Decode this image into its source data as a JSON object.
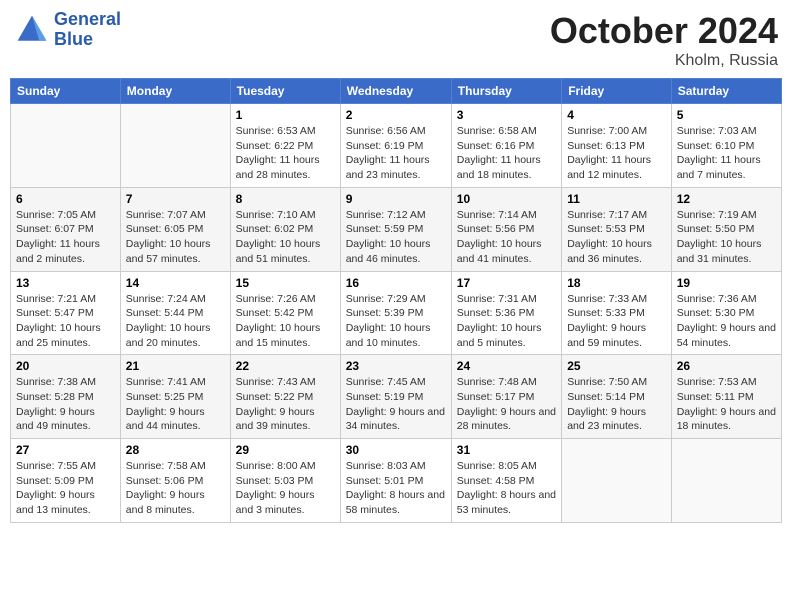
{
  "header": {
    "logo_line1": "General",
    "logo_line2": "Blue",
    "month": "October 2024",
    "location": "Kholm, Russia"
  },
  "weekdays": [
    "Sunday",
    "Monday",
    "Tuesday",
    "Wednesday",
    "Thursday",
    "Friday",
    "Saturday"
  ],
  "weeks": [
    [
      {
        "day": "",
        "info": ""
      },
      {
        "day": "",
        "info": ""
      },
      {
        "day": "1",
        "sunrise": "6:53 AM",
        "sunset": "6:22 PM",
        "daylight": "11 hours and 28 minutes."
      },
      {
        "day": "2",
        "sunrise": "6:56 AM",
        "sunset": "6:19 PM",
        "daylight": "11 hours and 23 minutes."
      },
      {
        "day": "3",
        "sunrise": "6:58 AM",
        "sunset": "6:16 PM",
        "daylight": "11 hours and 18 minutes."
      },
      {
        "day": "4",
        "sunrise": "7:00 AM",
        "sunset": "6:13 PM",
        "daylight": "11 hours and 12 minutes."
      },
      {
        "day": "5",
        "sunrise": "7:03 AM",
        "sunset": "6:10 PM",
        "daylight": "11 hours and 7 minutes."
      }
    ],
    [
      {
        "day": "6",
        "sunrise": "7:05 AM",
        "sunset": "6:07 PM",
        "daylight": "11 hours and 2 minutes."
      },
      {
        "day": "7",
        "sunrise": "7:07 AM",
        "sunset": "6:05 PM",
        "daylight": "10 hours and 57 minutes."
      },
      {
        "day": "8",
        "sunrise": "7:10 AM",
        "sunset": "6:02 PM",
        "daylight": "10 hours and 51 minutes."
      },
      {
        "day": "9",
        "sunrise": "7:12 AM",
        "sunset": "5:59 PM",
        "daylight": "10 hours and 46 minutes."
      },
      {
        "day": "10",
        "sunrise": "7:14 AM",
        "sunset": "5:56 PM",
        "daylight": "10 hours and 41 minutes."
      },
      {
        "day": "11",
        "sunrise": "7:17 AM",
        "sunset": "5:53 PM",
        "daylight": "10 hours and 36 minutes."
      },
      {
        "day": "12",
        "sunrise": "7:19 AM",
        "sunset": "5:50 PM",
        "daylight": "10 hours and 31 minutes."
      }
    ],
    [
      {
        "day": "13",
        "sunrise": "7:21 AM",
        "sunset": "5:47 PM",
        "daylight": "10 hours and 25 minutes."
      },
      {
        "day": "14",
        "sunrise": "7:24 AM",
        "sunset": "5:44 PM",
        "daylight": "10 hours and 20 minutes."
      },
      {
        "day": "15",
        "sunrise": "7:26 AM",
        "sunset": "5:42 PM",
        "daylight": "10 hours and 15 minutes."
      },
      {
        "day": "16",
        "sunrise": "7:29 AM",
        "sunset": "5:39 PM",
        "daylight": "10 hours and 10 minutes."
      },
      {
        "day": "17",
        "sunrise": "7:31 AM",
        "sunset": "5:36 PM",
        "daylight": "10 hours and 5 minutes."
      },
      {
        "day": "18",
        "sunrise": "7:33 AM",
        "sunset": "5:33 PM",
        "daylight": "9 hours and 59 minutes."
      },
      {
        "day": "19",
        "sunrise": "7:36 AM",
        "sunset": "5:30 PM",
        "daylight": "9 hours and 54 minutes."
      }
    ],
    [
      {
        "day": "20",
        "sunrise": "7:38 AM",
        "sunset": "5:28 PM",
        "daylight": "9 hours and 49 minutes."
      },
      {
        "day": "21",
        "sunrise": "7:41 AM",
        "sunset": "5:25 PM",
        "daylight": "9 hours and 44 minutes."
      },
      {
        "day": "22",
        "sunrise": "7:43 AM",
        "sunset": "5:22 PM",
        "daylight": "9 hours and 39 minutes."
      },
      {
        "day": "23",
        "sunrise": "7:45 AM",
        "sunset": "5:19 PM",
        "daylight": "9 hours and 34 minutes."
      },
      {
        "day": "24",
        "sunrise": "7:48 AM",
        "sunset": "5:17 PM",
        "daylight": "9 hours and 28 minutes."
      },
      {
        "day": "25",
        "sunrise": "7:50 AM",
        "sunset": "5:14 PM",
        "daylight": "9 hours and 23 minutes."
      },
      {
        "day": "26",
        "sunrise": "7:53 AM",
        "sunset": "5:11 PM",
        "daylight": "9 hours and 18 minutes."
      }
    ],
    [
      {
        "day": "27",
        "sunrise": "7:55 AM",
        "sunset": "5:09 PM",
        "daylight": "9 hours and 13 minutes."
      },
      {
        "day": "28",
        "sunrise": "7:58 AM",
        "sunset": "5:06 PM",
        "daylight": "9 hours and 8 minutes."
      },
      {
        "day": "29",
        "sunrise": "8:00 AM",
        "sunset": "5:03 PM",
        "daylight": "9 hours and 3 minutes."
      },
      {
        "day": "30",
        "sunrise": "8:03 AM",
        "sunset": "5:01 PM",
        "daylight": "8 hours and 58 minutes."
      },
      {
        "day": "31",
        "sunrise": "8:05 AM",
        "sunset": "4:58 PM",
        "daylight": "8 hours and 53 minutes."
      },
      {
        "day": "",
        "info": ""
      },
      {
        "day": "",
        "info": ""
      }
    ]
  ]
}
